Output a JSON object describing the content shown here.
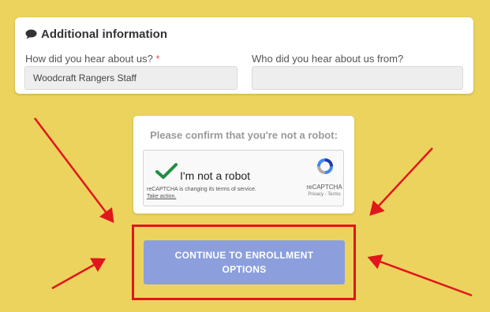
{
  "additional_info": {
    "title": "Additional information",
    "hear_about_label": "How did you hear about us?",
    "required_marker": "*",
    "hear_about_value": "Woodcraft Rangers Staff",
    "who_label": "Who did you hear about us from?",
    "who_value": ""
  },
  "captcha": {
    "heading": "Please confirm that you're not a robot:",
    "checkbox_label": "I'm not a robot",
    "notice": "reCAPTCHA is changing its terms of service.",
    "notice_link": "Take action.",
    "brand": "reCAPTCHA",
    "terms": "Privacy - Terms"
  },
  "continue_button": {
    "label": "CONTINUE TO ENROLLMENT OPTIONS"
  },
  "colors": {
    "background": "#ecd35e",
    "button": "#8c9fdc",
    "highlight": "#e0161c",
    "checkmark": "#1e8e3e"
  },
  "icons": {
    "section": "chat-bubble-icon",
    "check": "checkmark-icon",
    "recaptcha": "recaptcha-logo-icon"
  }
}
